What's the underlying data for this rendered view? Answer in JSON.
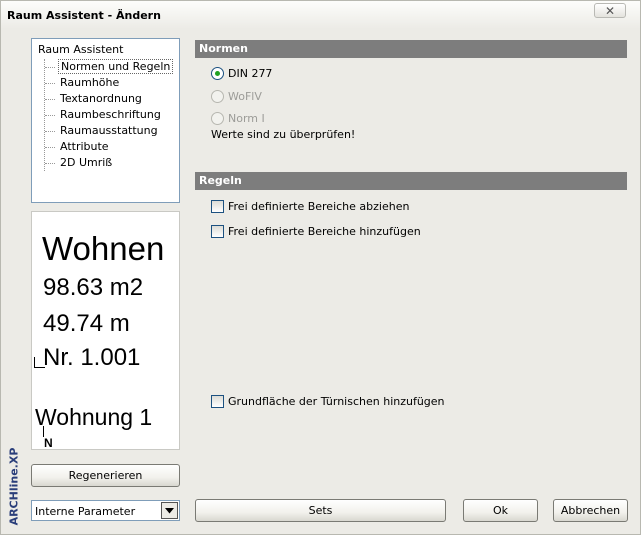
{
  "window": {
    "title": "Raum Assistent - Ändern",
    "close_glyph": "✕"
  },
  "tree": {
    "root": "Raum Assistent",
    "items": [
      {
        "label": "Normen und Regeln",
        "selected": true
      },
      {
        "label": "Raumhöhe"
      },
      {
        "label": "Textanordnung"
      },
      {
        "label": "Raumbeschriftung"
      },
      {
        "label": "Raumausstattung"
      },
      {
        "label": "Attribute"
      },
      {
        "label": "2D Umriß"
      }
    ]
  },
  "preview": {
    "name": "Wohnen",
    "area": "98.63 m2",
    "perimeter": "49.74 m",
    "number": "Nr. 1.001",
    "unit": "Wohnung 1",
    "north": "N"
  },
  "brand": "ARCHline.XP",
  "buttons": {
    "regenerate": "Regenerieren",
    "sets": "Sets",
    "ok": "Ok",
    "cancel": "Abbrechen"
  },
  "combo": {
    "value": "Interne Parameter",
    "arrow_icon": "chevron-down-icon"
  },
  "normen": {
    "header": "Normen",
    "options": [
      {
        "label": "DIN 277",
        "checked": true,
        "enabled": true
      },
      {
        "label": "WoFlV",
        "checked": false,
        "enabled": false
      },
      {
        "label": "Norm I",
        "checked": false,
        "enabled": false
      }
    ],
    "note": "Werte sind zu überprüfen!"
  },
  "regeln": {
    "header": "Regeln",
    "checks": [
      {
        "label": "Frei definierte Bereiche abziehen",
        "checked": false
      },
      {
        "label": "Frei definierte Bereiche hinzufügen",
        "checked": false
      },
      {
        "label": "Grundfläche der Türnischen hinzufügen",
        "checked": false
      }
    ]
  }
}
